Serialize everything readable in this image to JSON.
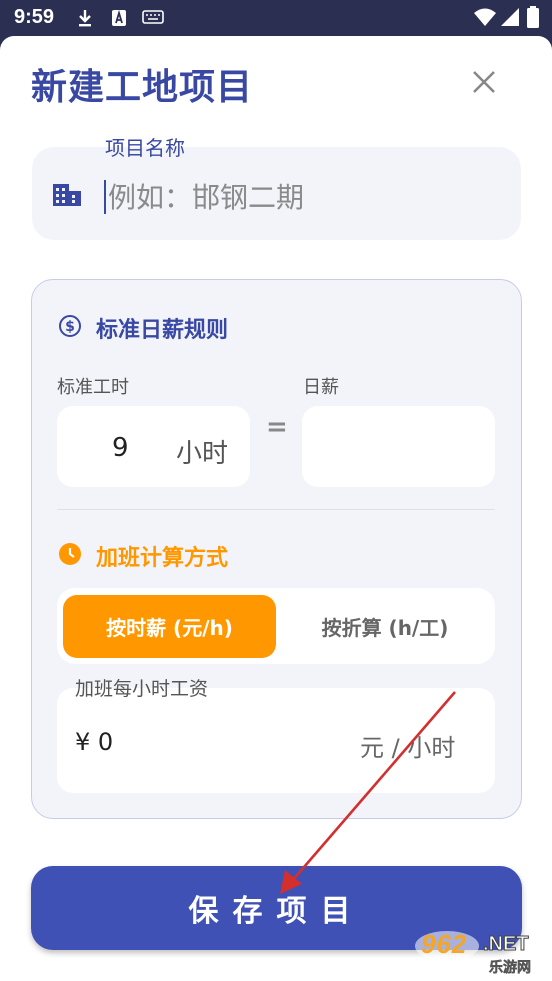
{
  "status_bar": {
    "time": "9:59",
    "icons": [
      "download-icon",
      "a-badge-icon",
      "keyboard-icon",
      "wifi-icon",
      "signal-icon",
      "battery-icon"
    ]
  },
  "dialog": {
    "title": "新建工地项目",
    "close_icon": "close-icon"
  },
  "project_name": {
    "label": "项目名称",
    "placeholder": "例如：邯钢二期",
    "value": "",
    "icon": "building-icon"
  },
  "daily_wage_rule": {
    "title": "标准日薪规则",
    "icon": "dollar-circle-icon",
    "standard_hours_label": "标准工时",
    "standard_hours_value": "9",
    "standard_hours_unit": "小时",
    "equals": "=",
    "daily_wage_label": "日薪",
    "daily_wage_value": ""
  },
  "overtime": {
    "title": "加班计算方式",
    "icon": "clock-icon",
    "options": [
      "按时薪 (元/h)",
      "按折算 (h/工)"
    ],
    "selected_index": 0,
    "hourly_label": "加班每小时工资",
    "hourly_value": "¥ 0",
    "hourly_unit": "元 / 小时"
  },
  "save_button": {
    "label": "保存项目"
  },
  "watermark": {
    "number": "962",
    "suffix": ".NET",
    "sub": "乐游网"
  },
  "colors": {
    "primary": "#3f51b5",
    "title": "#3949a3",
    "accent_orange": "#ff9800",
    "card_bg": "#f3f4f9",
    "annotation_red": "#d32f2f"
  }
}
